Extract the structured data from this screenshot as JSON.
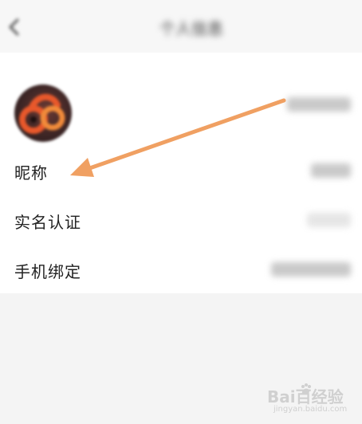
{
  "header": {
    "title": "个人信息"
  },
  "profile": {
    "avatar_value": "",
    "rows": [
      {
        "label": "昵称",
        "value": ""
      },
      {
        "label": "实名认证",
        "value": ""
      },
      {
        "label": "手机绑定",
        "value": ""
      }
    ]
  },
  "watermark": {
    "main": "Bai百经验",
    "sub": "jingyan.baidu.com"
  },
  "colors": {
    "arrow": "#f0a062",
    "panel": "#ffffff",
    "background": "#f4f4f4",
    "avatar_logo": "#e8582b"
  },
  "icons": {
    "back": "chevron-left-icon",
    "watermark_paw": "paw-icon"
  }
}
